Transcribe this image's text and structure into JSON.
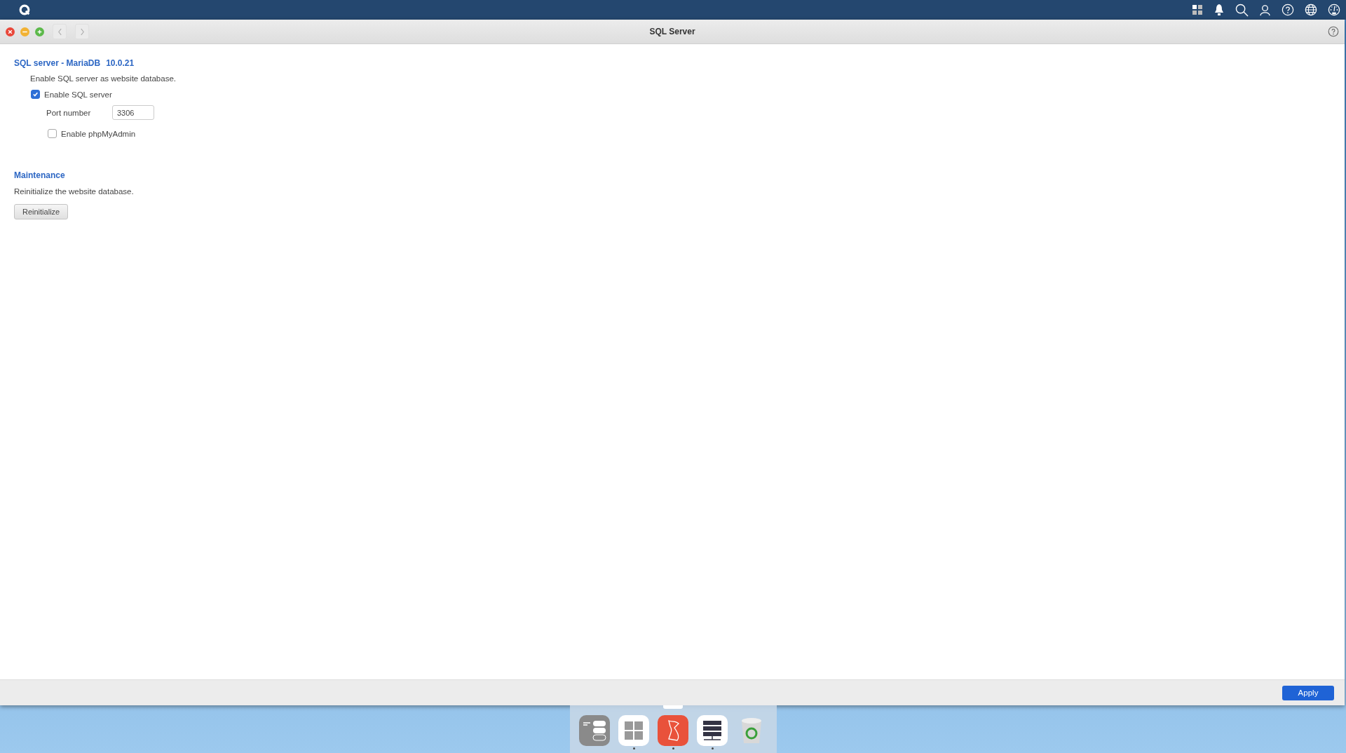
{
  "window": {
    "title": "SQL Server"
  },
  "sql_section": {
    "title": "SQL server - MariaDB",
    "version": "10.0.21",
    "description": "Enable SQL server as website database.",
    "enable_sql": {
      "label": "Enable SQL server",
      "checked": true
    },
    "port": {
      "label": "Port number",
      "value": "3306"
    },
    "enable_phpmyadmin": {
      "label": "Enable phpMyAdmin",
      "checked": false
    }
  },
  "maintenance": {
    "title": "Maintenance",
    "description": "Reinitialize the website database.",
    "button": "Reinitialize"
  },
  "footer": {
    "button": "Apply"
  },
  "dock": [
    {
      "kind": "toggles",
      "running": false
    },
    {
      "kind": "grid",
      "running": true
    },
    {
      "kind": "app",
      "running": true
    },
    {
      "kind": "server",
      "running": true
    },
    {
      "kind": "trash",
      "running": false
    }
  ]
}
